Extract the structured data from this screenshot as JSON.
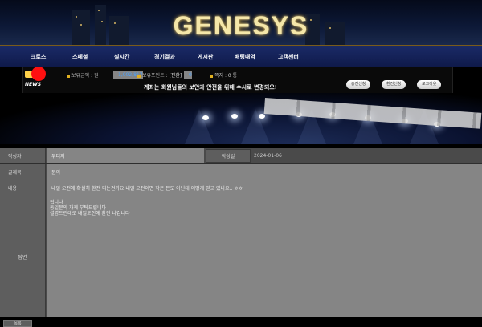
{
  "brand": {
    "logo_text": "GENESYS"
  },
  "nav": {
    "items": [
      "크로스",
      "스페셜",
      "실시간",
      "경기결과",
      "게시판",
      "배팅내역",
      "고객센터"
    ]
  },
  "infobar": {
    "money_label": "보유금액 :",
    "money_value": "1,002,817",
    "money_unit": "원",
    "point_label": "보유포인트 :",
    "point_value": "0",
    "point_action": "[전환]",
    "note_label": "쪽지 :",
    "note_value": "0",
    "note_unit": "통",
    "news_label": "NEWS",
    "news_text": "계좌는 회원님들의 보안과 안전을 위해 수시로 변경되오!",
    "buttons": [
      "충전신청",
      "환전신청",
      "로그아웃"
    ]
  },
  "form": {
    "author_label": "작성자",
    "author_value": "두더지",
    "date_label": "작성일",
    "date_value": "2024-01-06",
    "subject_label": "글제목",
    "subject_value": "문의",
    "content_label": "내용",
    "content_value": "내일 오전에 확실히 환전 되는건가요 내일 오전이면 작은 돈도 아닌데 어떻게 믿고 있나요.. ㅎㅎ",
    "reply_label": "답변",
    "reply_lines": [
      "됩니다",
      "동일문의 자제 부탁드립니다",
      "설명드린대로 내일오전에 환전 나갑니다"
    ]
  },
  "list_button": "목록",
  "colors": {
    "accent": "#4aa3ff",
    "alert": "#ff1010",
    "nav_bg": "#1a2a66"
  }
}
